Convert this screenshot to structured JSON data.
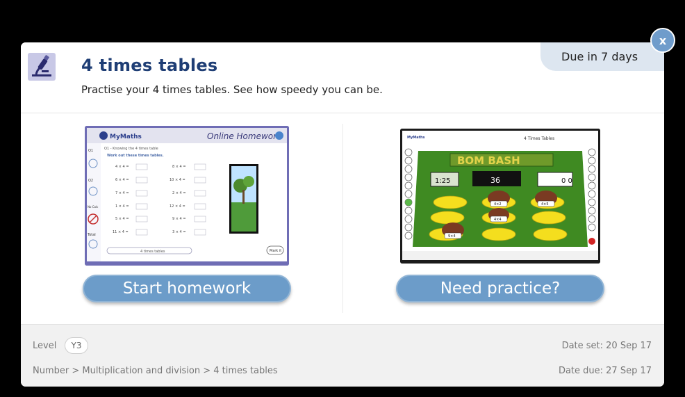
{
  "header": {
    "title": "4 times tables",
    "subtitle": "Practise your 4 times tables. See how speedy you can be.",
    "due_badge": "Due in 7 days",
    "icon": "microscope-icon"
  },
  "close": {
    "label": "x",
    "icon": "close-icon"
  },
  "homework_preview": {
    "logo": "MyMaths",
    "heading": "Online Homework",
    "question_title": "Q1 - Knowing the 4 times table",
    "instruction": "Work out these times tables.",
    "left_questions": [
      "4 × 4 =",
      "6 × 4 =",
      "7 × 4 =",
      "1 × 4 =",
      "5 × 4 =",
      "11 × 4 ="
    ],
    "right_questions": [
      "8 × 4 =",
      "10 × 4 =",
      "2 × 4 =",
      "12 × 4 =",
      "9 × 4 =",
      "3 × 4 ="
    ],
    "side_labels": [
      "Q1",
      "Q2",
      "No Calc",
      "Total"
    ],
    "footer_label": "4 times tables",
    "mark_label": "Mark it"
  },
  "practice_preview": {
    "logo": "MyMaths",
    "title": "4 Times Tables",
    "game_name": "BOM BASH",
    "timer": "1:25",
    "target": "36",
    "score": "0 0",
    "moles": [
      "4×2",
      "4×5",
      "4×4",
      "9×4"
    ]
  },
  "actions": {
    "start_homework": "Start homework",
    "need_practice": "Need practice?"
  },
  "footer": {
    "level_label": "Level",
    "level_value": "Y3",
    "date_set": "Date set: 20 Sep 17",
    "breadcrumb": "Number > Multiplication and division > 4 times tables",
    "date_due": "Date due: 27 Sep 17"
  },
  "colors": {
    "title": "#1f3e75",
    "button": "#6c9cc9",
    "badge_bg": "#dde6f0",
    "footer_bg": "#f1f1f1",
    "game_green": "#3f8a22"
  }
}
